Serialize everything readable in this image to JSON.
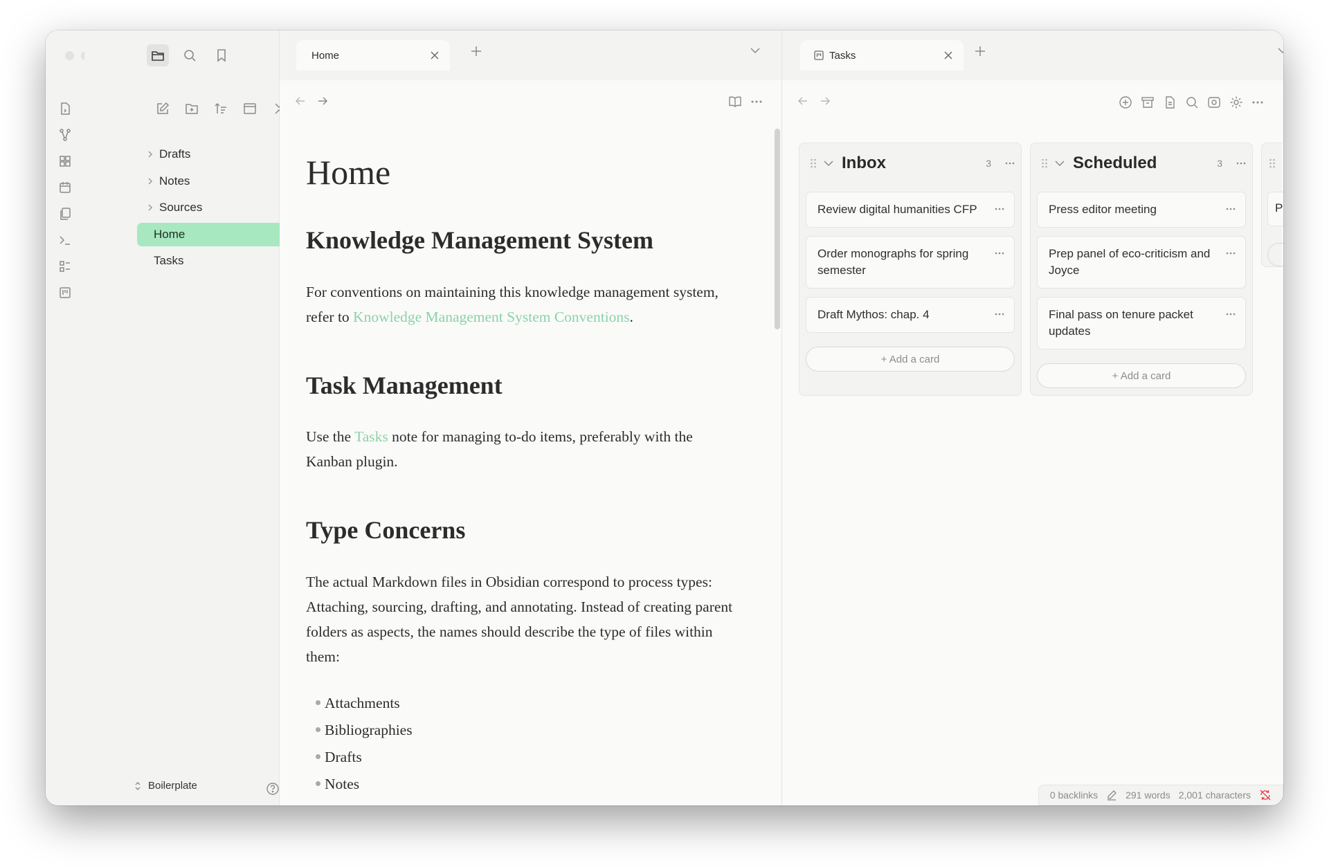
{
  "sidebar": {
    "tree": [
      {
        "label": "Drafts",
        "type": "folder"
      },
      {
        "label": "Notes",
        "type": "folder"
      },
      {
        "label": "Sources",
        "type": "folder"
      },
      {
        "label": "Home",
        "type": "file",
        "active": true
      },
      {
        "label": "Tasks",
        "type": "file"
      }
    ],
    "vault_name": "Boilerplate"
  },
  "left_pane": {
    "tab_label": "Home",
    "note": {
      "title": "Home",
      "sections": [
        {
          "heading": "Knowledge Management System",
          "text_before": "For conventions on maintaining this knowledge management system, refer to ",
          "link": "Knowledge Management System Conventions",
          "text_after": "."
        },
        {
          "heading": "Task Management",
          "text_before": "Use the ",
          "link": "Tasks",
          "text_after": " note for managing to-do items, preferably with the Kanban plugin."
        },
        {
          "heading": "Type Concerns",
          "text": "The actual Markdown files in Obsidian correspond to process types: Attaching, sourcing, drafting, and annotating. Instead of creating parent folders as aspects, the names should describe the type of files within them:"
        }
      ],
      "list": [
        "Attachments",
        "Bibliographies",
        "Drafts",
        "Notes"
      ]
    }
  },
  "right_pane": {
    "tab_label": "Tasks",
    "lanes": [
      {
        "title": "Inbox",
        "count": "3",
        "cards": [
          "Review digital humanities CFP",
          "Order monographs for spring semester",
          "Draft Mythos: chap. 4"
        ],
        "add_label": "+ Add a card"
      },
      {
        "title": "Scheduled",
        "count": "3",
        "cards": [
          "Press editor meeting",
          "Prep panel of eco-criticism and Joyce",
          "Final pass on tenure packet updates"
        ],
        "add_label": "+ Add a card"
      }
    ],
    "peek_lane_letter": "P"
  },
  "status": {
    "backlinks": "0 backlinks",
    "words": "291 words",
    "characters": "2,001 characters"
  },
  "colors": {
    "accent": "#a7e8c0",
    "link": "#8ad3a6",
    "sync_error": "#e0444b"
  }
}
